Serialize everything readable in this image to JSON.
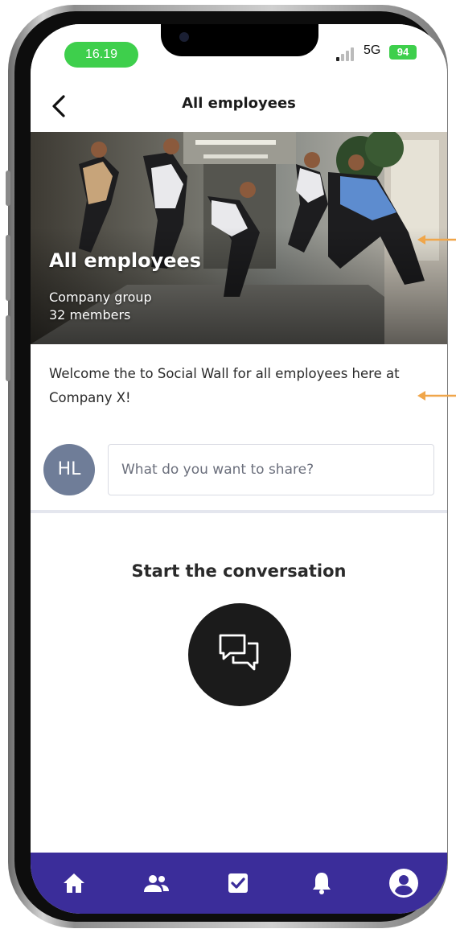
{
  "status_bar": {
    "time": "16.19",
    "network": "5G",
    "battery": "94",
    "colors": {
      "pill": "#3ecf4c"
    }
  },
  "header": {
    "back_icon": "chevron-left-icon",
    "title": "All employees"
  },
  "hero": {
    "title": "All employees",
    "subtitle": "Company group",
    "members": "32 members"
  },
  "welcome_text": "Welcome the to Social Wall for all employees here at Company X!",
  "composer": {
    "avatar_initials": "HL",
    "placeholder": "What do you want to share?"
  },
  "empty_state": {
    "title": "Start the conversation",
    "icon": "chat-bubbles-icon"
  },
  "bottom_nav": {
    "items": [
      {
        "icon": "home-icon"
      },
      {
        "icon": "people-icon"
      },
      {
        "icon": "checkbox-icon"
      },
      {
        "icon": "bell-icon"
      },
      {
        "icon": "account-icon"
      }
    ],
    "color": "#3b2d9a"
  },
  "annotation_color": "#f0a64a"
}
